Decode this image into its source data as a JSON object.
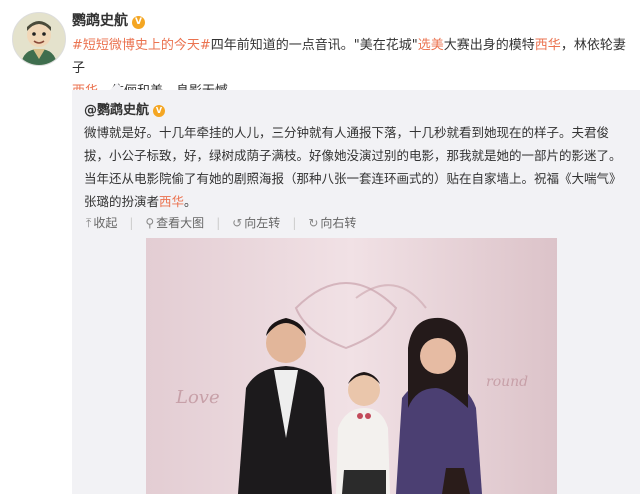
{
  "post": {
    "author": "鹦鹉史航",
    "verified_badge": "V",
    "hashtag": "#短短微博史上的今天#",
    "text_1": "四年前知道的一点音讯。\"美在花城\"",
    "link_1": "选美",
    "text_2": "大赛出身的模特",
    "link_2": "西华",
    "text_3": "，林依轮妻子",
    "link_3": "西华",
    "text_4": "，伉俪和美，息影无憾。"
  },
  "repost": {
    "author": "@鹦鹉史航",
    "verified_badge": "V",
    "text_main": "微博就是好。十几年牵挂的人儿，三分钟就有人通报下落，十几秒就看到她现在的样子。夫君俊拔，小公子标致，好，绿树成荫子满枝。好像她没演过别的电影，那我就是她的一部片的影迷了。当年还从电影院偷了有她的剧照海报（那种八张一套连环画式的）贴在自家墙上。祝福《大喘气》张璐的扮演者",
    "text_link": "西华",
    "text_end": "。",
    "actions": {
      "collapse": "收起",
      "view_large": "查看大图",
      "rotate_left": "向左转",
      "rotate_right": "向右转"
    },
    "photo_backdrop_text_left": "Love",
    "photo_backdrop_text_right": "round"
  },
  "colors": {
    "link": "#eb7350",
    "topic": "#3b8ad9",
    "repost_bg": "#f2f2f5",
    "badge": "#f4a623"
  },
  "icons": [
    "avatar-illustration",
    "verified-v-icon",
    "topic-icon",
    "collapse-arrow-icon",
    "zoom-icon",
    "rotate-left-icon",
    "rotate-right-icon"
  ]
}
